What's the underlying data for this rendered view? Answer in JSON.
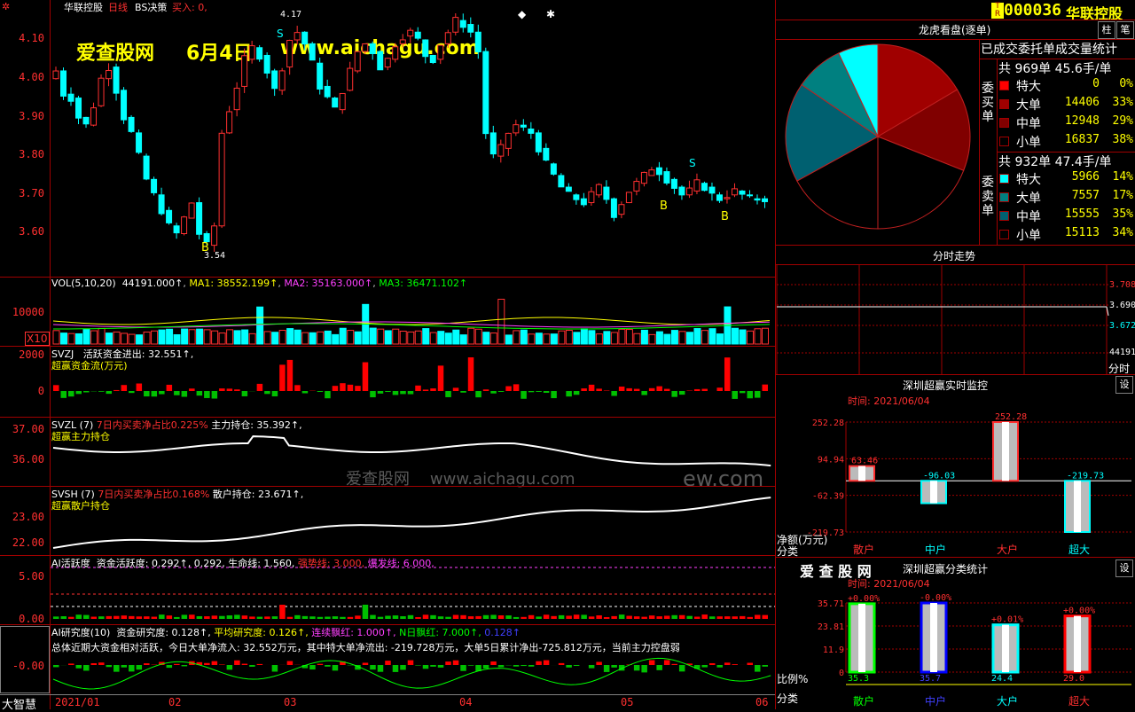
{
  "header": {
    "stock_name": "华联控股",
    "period": "日线",
    "strategy": "BS决策",
    "buy_in": "买入: 0,"
  },
  "watermark": {
    "site_cn": "爱查股网",
    "date": "6月4日",
    "url": "www.aichagu.com",
    "center_text": "爱查股网    www.aichagu.com",
    "center_tail": "ew.com"
  },
  "main_chart": {
    "y_ticks": [
      "4.10",
      "4.00",
      "3.90",
      "3.80",
      "3.70",
      "3.60"
    ],
    "high_marker": "4.17",
    "low_marker": "3.54",
    "signal_s": "S",
    "signal_b": "B"
  },
  "vol_panel": {
    "title": "VOL(5,10,20)",
    "value": "44191.000↑",
    "ma1": "MA1: 38552.199↑",
    "ma2": "MA2: 35163.000↑",
    "ma3": "MA3: 36471.102↑",
    "y_tick": "10000",
    "multiplier": "X10"
  },
  "svzj_panel": {
    "title": "SVZJ",
    "label": "活跃资金进出: 32.551↑,",
    "subtitle": "超赢资金流(万元)",
    "y_ticks": [
      "2000",
      "0"
    ]
  },
  "svzl_panel": {
    "title": "SVZL (7)",
    "ratio": "7日内买卖净占比0.225%",
    "hold": "主力持仓: 35.392↑,",
    "subtitle": "超赢主力持仓",
    "y_ticks": [
      "37.00",
      "36.00"
    ]
  },
  "svsh_panel": {
    "title": "SVSH (7)",
    "ratio": "7日内买卖净占比0.168%",
    "hold": "散户持仓: 23.671↑,",
    "subtitle": "超赢散户持仓",
    "y_ticks": [
      "23.00",
      "22.00"
    ]
  },
  "ai_active_panel": {
    "title": "AI活跃度",
    "fund": "资金活跃度: 0.292↑,",
    "v2": "0.292,",
    "life": "生命线: 1.560,",
    "strong": "强势线: 3.000,",
    "burst": "爆发线: 6.000,",
    "y_ticks": [
      "5.00",
      "0.00"
    ]
  },
  "ai_research_panel": {
    "title": "AI研究度(10)",
    "fund": "资金研究度: 0.128↑,",
    "avg": "平均研究度: 0.126↑,",
    "red": "连续飘红: 1.000↑,",
    "nred": "N日飘红: 7.000↑,",
    "v": "0.128↑",
    "summary": "总体近期大资金相对活跃，今日大单净流入: 32.552万元，其中特大单净流出: -219.728万元，大单5日累计净出-725.812万元，当前主力控盘弱",
    "y_tick": "-0.00"
  },
  "x_axis": {
    "corner": "大智慧",
    "labels": [
      "2021/01",
      "02",
      "03",
      "04",
      "05",
      "06"
    ]
  },
  "right_header": {
    "code": "000036",
    "name": "华联控股",
    "btn_bar": "柱",
    "btn_pen": "笔"
  },
  "longhu": {
    "title": "龙虎看盘(逐单)",
    "stat_title": "已成交委托单成交量统计",
    "buy_side": "委买单",
    "sell_side": "委卖单",
    "buy_total": "共 969单 45.6手/单",
    "sell_total": "共 932单 47.4手/单",
    "buy_rows": [
      {
        "label": "特大",
        "vol": "0",
        "pct": "0%",
        "color": "#ff0000"
      },
      {
        "label": "大单",
        "vol": "14406",
        "pct": "33%",
        "color": "#a00000"
      },
      {
        "label": "中单",
        "vol": "12948",
        "pct": "29%",
        "color": "#800000"
      },
      {
        "label": "小单",
        "vol": "16837",
        "pct": "38%",
        "color": "#000000"
      }
    ],
    "sell_rows": [
      {
        "label": "特大",
        "vol": "5966",
        "pct": "14%",
        "color": "#00ffff"
      },
      {
        "label": "大单",
        "vol": "7557",
        "pct": "17%",
        "color": "#008080"
      },
      {
        "label": "中单",
        "vol": "15555",
        "pct": "35%",
        "color": "#006070"
      },
      {
        "label": "小单",
        "vol": "15113",
        "pct": "34%",
        "color": "#000000"
      }
    ]
  },
  "intraday": {
    "title": "分时走势",
    "prices": [
      "3.708",
      "3.690",
      "3.672"
    ],
    "vol": "44191",
    "label": "分时"
  },
  "monitor": {
    "title": "深圳超赢实时监控",
    "btn": "设",
    "time": "时间: 2021/06/04",
    "y_ticks": [
      "252.28",
      "94.94",
      "-62.39",
      "-219.73"
    ],
    "bars": [
      {
        "name": "散户",
        "value": "63.46"
      },
      {
        "name": "中户",
        "value": "-96.03"
      },
      {
        "name": "大户",
        "value": "252.28"
      },
      {
        "name": "超大",
        "value": "-219.73"
      }
    ],
    "ylabel": "净额(万元)",
    "xlabel": "分类"
  },
  "category": {
    "brand": "爱 查 股 网",
    "title": "深圳超赢分类统计",
    "btn": "设",
    "time": "时间: 2021/06/04",
    "y_ticks": [
      "35.71",
      "23.81",
      "11.9",
      "0"
    ],
    "bars": [
      {
        "name": "散户",
        "value": "35.3",
        "change": "+0.00%"
      },
      {
        "name": "中户",
        "value": "35.7",
        "change": "-0.00%"
      },
      {
        "name": "大户",
        "value": "24.4",
        "change": "+0.01%"
      },
      {
        "name": "超大",
        "value": "29.0",
        "change": "+0.00%"
      }
    ],
    "ylabel": "比例%",
    "xlabel": "分类"
  },
  "colors": {
    "bg": "#000000",
    "grid": "#a00000",
    "up": "#ff3030",
    "down": "#00ffff",
    "label": "#ffff00"
  }
}
